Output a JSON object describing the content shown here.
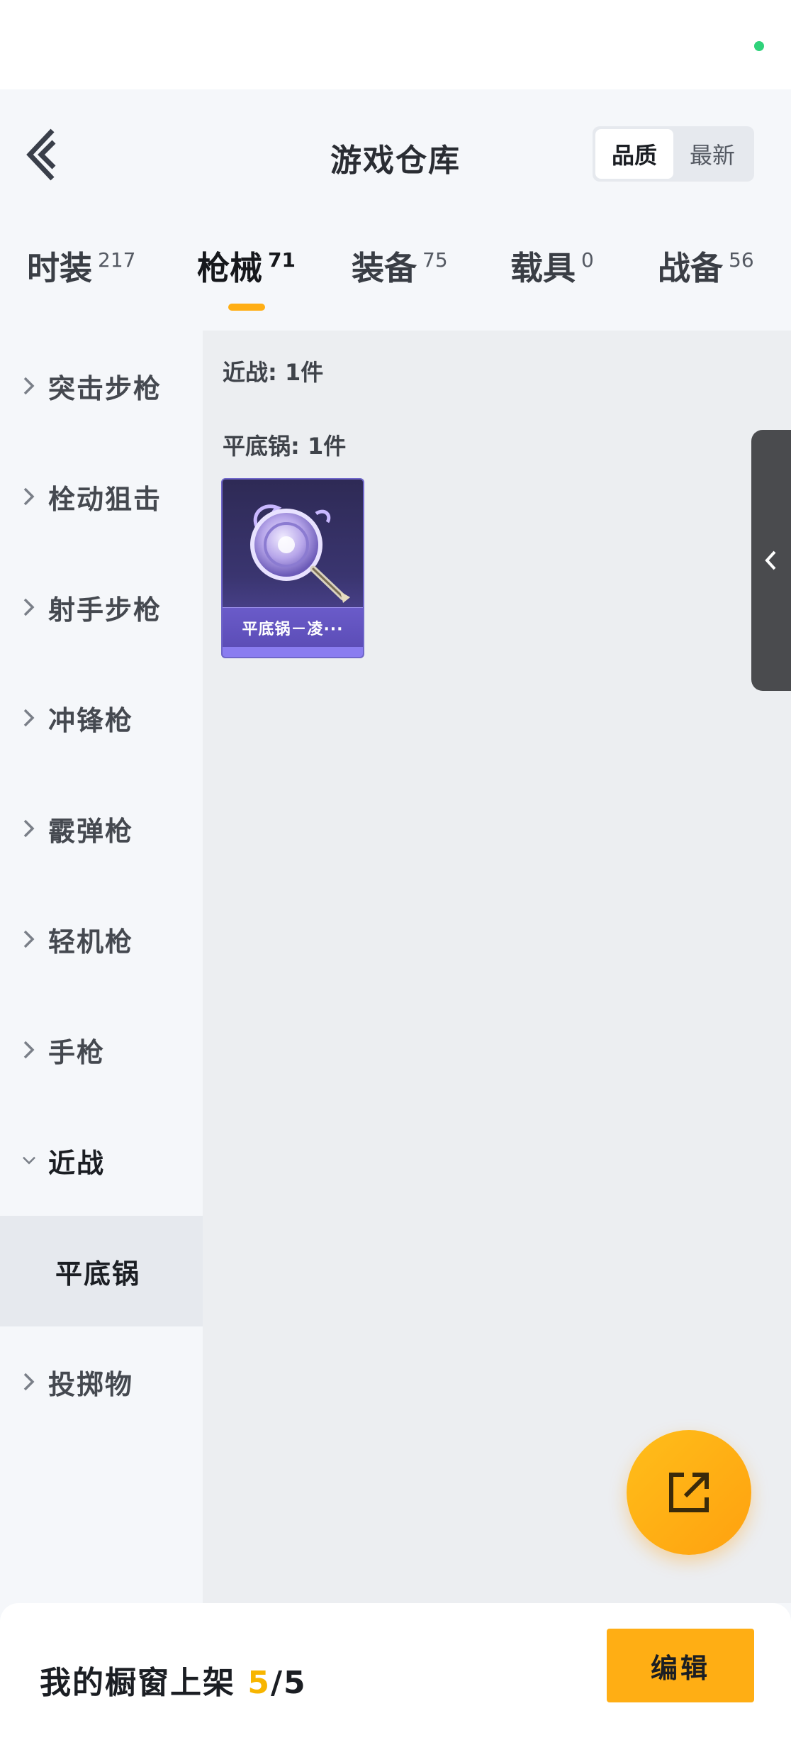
{
  "header": {
    "title": "游戏仓库",
    "sort_options": [
      "品质",
      "最新"
    ],
    "sort_selected": "品质"
  },
  "tabs": [
    {
      "label": "时装",
      "count": "217"
    },
    {
      "label": "枪械",
      "count": "71"
    },
    {
      "label": "装备",
      "count": "75"
    },
    {
      "label": "载具",
      "count": "0"
    },
    {
      "label": "战备",
      "count": "56"
    }
  ],
  "active_tab": "枪械",
  "sidebar": {
    "categories": [
      {
        "label": "突击步枪"
      },
      {
        "label": "栓动狙击"
      },
      {
        "label": "射手步枪"
      },
      {
        "label": "冲锋枪"
      },
      {
        "label": "霰弹枪"
      },
      {
        "label": "轻机枪"
      },
      {
        "label": "手枪"
      },
      {
        "label": "近战"
      },
      {
        "label": "投掷物"
      }
    ],
    "expanded": "近战",
    "subcategory": "平底锅"
  },
  "content": {
    "group_title": "近战: 1件",
    "subgroup_title": "平底锅: 1件",
    "items": [
      {
        "name": "平底锅－凌···",
        "icon": "frying-pan-icon"
      }
    ]
  },
  "bottom_bar": {
    "showcase_label": "我的橱窗上架 ",
    "showcase_used": "5",
    "showcase_total": "/5",
    "edit_label": "编辑"
  },
  "colors": {
    "accent": "#ffae14",
    "count_highlight": "#f7b500",
    "status_dot": "#2fd27a",
    "item_card": "#5c4db7"
  }
}
